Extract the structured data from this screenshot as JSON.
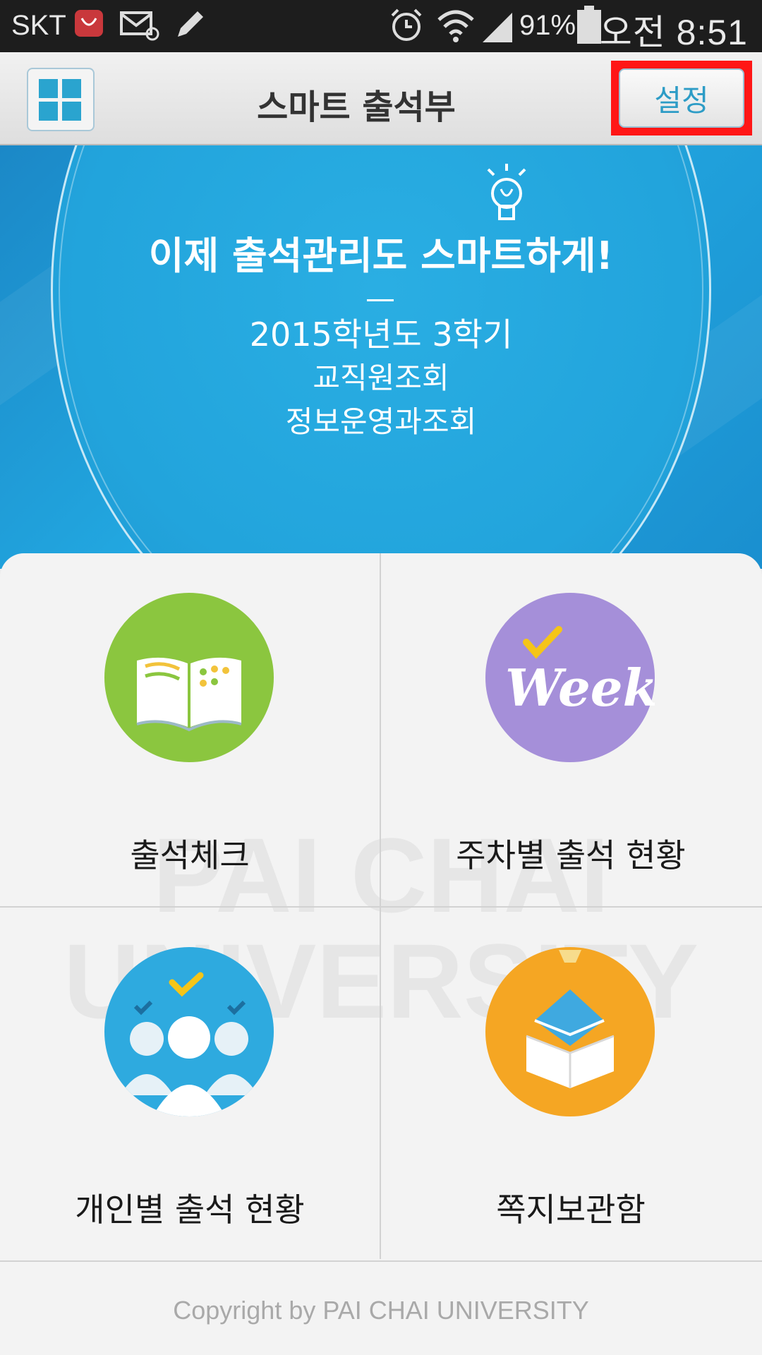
{
  "status_bar": {
    "carrier": "SKT",
    "battery": "91%",
    "time": "오전 8:51",
    "icons": [
      "notification-app-icon",
      "mail-icon",
      "pencil-icon",
      "alarm-icon",
      "wifi-icon",
      "signal-icon",
      "battery-icon"
    ]
  },
  "app_bar": {
    "title": "스마트 출석부",
    "settings_label": "설정",
    "highlight_color": "#ff1616"
  },
  "banner": {
    "headline": "이제 출석관리도 스마트하게!",
    "term": "2015학년도 3학기",
    "line2": "교직원조회",
    "line3": "정보운영과조회"
  },
  "menu": {
    "items": [
      {
        "label": "출석체크",
        "icon": "open-book-icon",
        "color": "#8bc63f"
      },
      {
        "label": "주차별 출석 현황",
        "icon": "week-check-icon",
        "color": "#a58fd9"
      },
      {
        "label": "개인별 출석 현황",
        "icon": "people-check-icon",
        "color": "#2eaadf"
      },
      {
        "label": "쪽지보관함",
        "icon": "message-box-icon",
        "color": "#f5a623"
      }
    ]
  },
  "watermark": {
    "line1": "PAI CHAI",
    "line2": "UNIVERSITY"
  },
  "footer": {
    "copyright": "Copyright by PAI CHAI UNIVERSITY"
  }
}
